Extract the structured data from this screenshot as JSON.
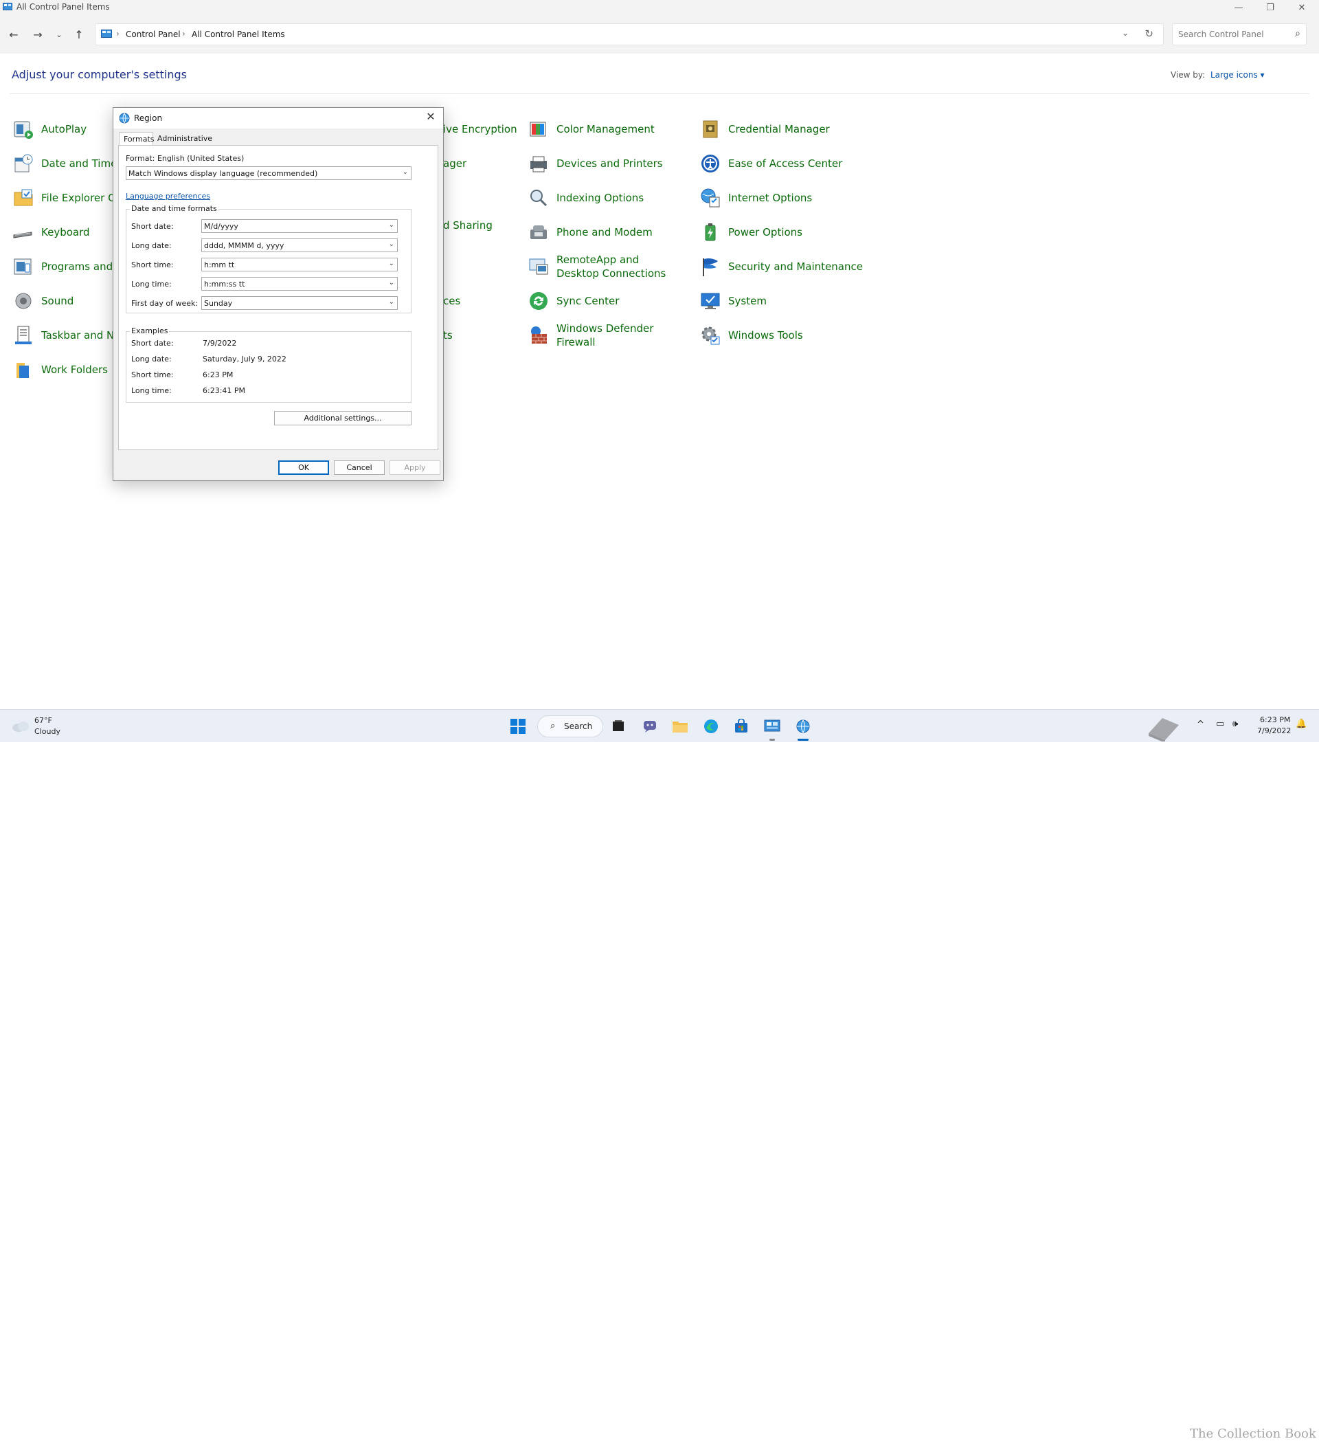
{
  "window": {
    "title": "All Control Panel Items"
  },
  "nav": {
    "breadcrumbs": [
      "Control Panel",
      "All Control Panel Items"
    ],
    "search_placeholder": "Search Control Panel"
  },
  "main": {
    "heading": "Adjust your computer's settings",
    "view_by_label": "View by:",
    "view_by_value": "Large icons ▾"
  },
  "items": {
    "col1": [
      "AutoPlay",
      "Date and Time",
      "File Explorer O",
      "Keyboard",
      "Programs and",
      "Sound",
      "Taskbar and Na",
      "Work Folders"
    ],
    "col2_partial": [
      "ive Encryption",
      "ager",
      "d Sharing",
      "ces",
      "ts"
    ],
    "col3": [
      "Color Management",
      "Devices and Printers",
      "Indexing Options",
      "Phone and Modem",
      "RemoteApp and Desktop Connections",
      "Sync Center",
      "Windows Defender Firewall"
    ],
    "col4": [
      "Credential Manager",
      "Ease of Access Center",
      "Internet Options",
      "Power Options",
      "Security and Maintenance",
      "System",
      "Windows Tools"
    ]
  },
  "dialog": {
    "title": "Region",
    "tabs": [
      "Formats",
      "Administrative"
    ],
    "format_label": "Format: English (United States)",
    "format_value": "Match Windows display language (recommended)",
    "language_link": "Language preferences",
    "dt_group_title": "Date and time formats",
    "fields": [
      {
        "label": "Short date:",
        "value": "M/d/yyyy"
      },
      {
        "label": "Long date:",
        "value": "dddd, MMMM d, yyyy"
      },
      {
        "label": "Short time:",
        "value": "h:mm tt"
      },
      {
        "label": "Long time:",
        "value": "h:mm:ss tt"
      },
      {
        "label": "First day of week:",
        "value": "Sunday"
      }
    ],
    "examples_title": "Examples",
    "examples": [
      {
        "label": "Short date:",
        "value": "7/9/2022"
      },
      {
        "label": "Long date:",
        "value": "Saturday, July 9, 2022"
      },
      {
        "label": "Short time:",
        "value": "6:23 PM"
      },
      {
        "label": "Long time:",
        "value": "6:23:41 PM"
      }
    ],
    "additional_button": "Additional settings...",
    "ok": "OK",
    "cancel": "Cancel",
    "apply": "Apply"
  },
  "taskbar": {
    "temp": "67°F",
    "condition": "Cloudy",
    "search_label": "Search",
    "time": "6:23 PM",
    "date": "7/9/2022",
    "watermark": "The Collection Book"
  },
  "colors": {
    "link_green": "#0b6a0b",
    "heading_blue": "#1e3287",
    "accent": "#0067c0"
  }
}
